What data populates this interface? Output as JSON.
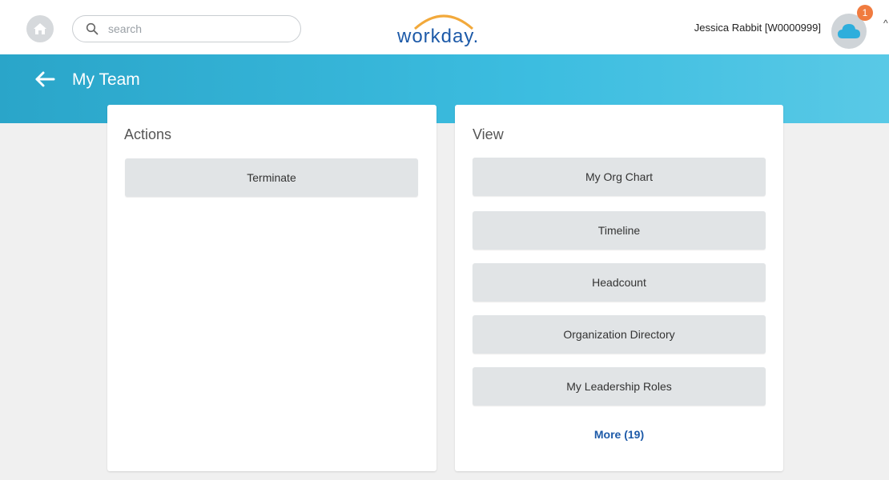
{
  "header": {
    "search_placeholder": "search",
    "logo_text": "workday.",
    "user_label": "Jessica Rabbit [W0000999]",
    "notification_count": "1"
  },
  "page": {
    "title": "My Team"
  },
  "actions_panel": {
    "title": "Actions",
    "buttons": [
      "Terminate"
    ]
  },
  "view_panel": {
    "title": "View",
    "buttons": [
      "My Org Chart",
      "Timeline",
      "Headcount",
      "Organization Directory",
      "My Leadership Roles"
    ],
    "more_label": "More (19)"
  },
  "colors": {
    "banner": "#2aa5c9",
    "logo": "#1d5aa8",
    "logo_arc": "#f2a93b",
    "badge": "#f07b3f",
    "button_bg": "#e1e4e6"
  },
  "icons": {
    "home": "home-icon",
    "search": "search-icon",
    "back": "arrow-left-icon",
    "avatar": "cloud-icon",
    "caret": "caret-icon"
  }
}
